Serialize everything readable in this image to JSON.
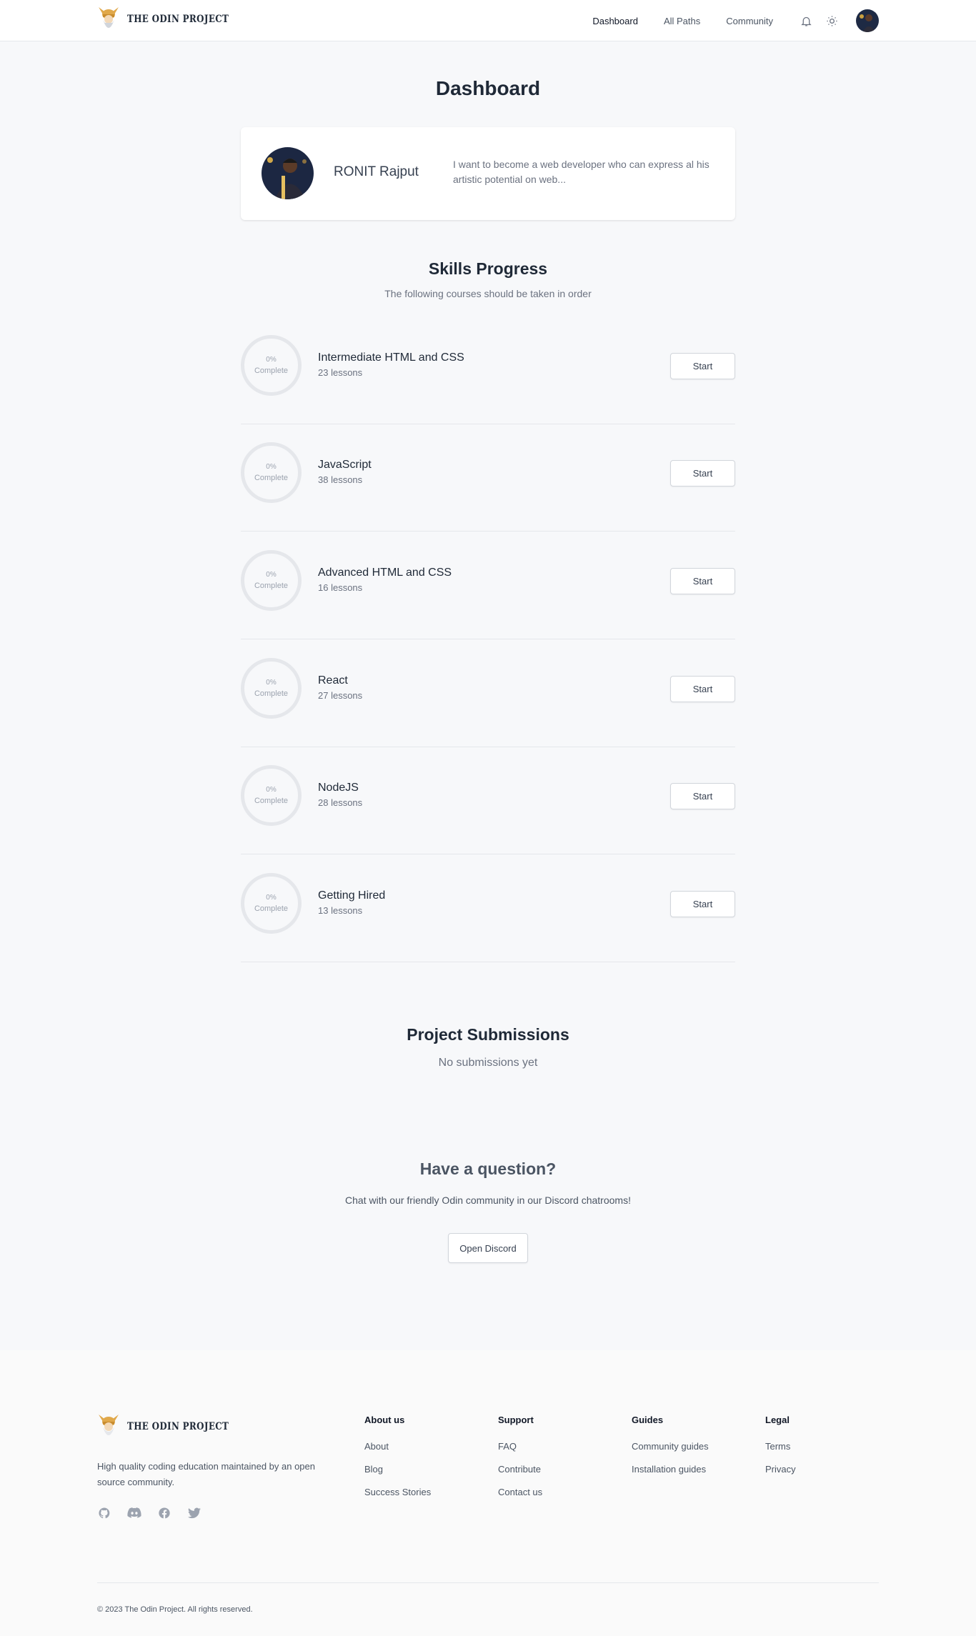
{
  "header": {
    "brand": "THE ODIN PROJECT",
    "nav": [
      "Dashboard",
      "All Paths",
      "Community"
    ],
    "icons": [
      "bell-icon",
      "sun-icon"
    ]
  },
  "main": {
    "title": "Dashboard",
    "profile": {
      "name": "RONIT Rajput",
      "bio": "I want to become a web developer who can express al his artistic potential on web..."
    },
    "skills": {
      "title": "Skills Progress",
      "subtitle": "The following courses should be taken in order",
      "courses": [
        {
          "name": "Intermediate HTML and CSS",
          "lessons": "23 lessons",
          "percent": "0%",
          "complete_label": "Complete",
          "button": "Start"
        },
        {
          "name": "JavaScript",
          "lessons": "38 lessons",
          "percent": "0%",
          "complete_label": "Complete",
          "button": "Start"
        },
        {
          "name": "Advanced HTML and CSS",
          "lessons": "16 lessons",
          "percent": "0%",
          "complete_label": "Complete",
          "button": "Start"
        },
        {
          "name": "React",
          "lessons": "27 lessons",
          "percent": "0%",
          "complete_label": "Complete",
          "button": "Start"
        },
        {
          "name": "NodeJS",
          "lessons": "28 lessons",
          "percent": "0%",
          "complete_label": "Complete",
          "button": "Start"
        },
        {
          "name": "Getting Hired",
          "lessons": "13 lessons",
          "percent": "0%",
          "complete_label": "Complete",
          "button": "Start"
        }
      ]
    },
    "submissions": {
      "title": "Project Submissions",
      "empty": "No submissions yet"
    },
    "question": {
      "title": "Have a question?",
      "text": "Chat with our friendly Odin community in our Discord chatrooms!",
      "button": "Open Discord"
    }
  },
  "footer": {
    "brand": "THE ODIN PROJECT",
    "tagline": "High quality coding education maintained by an open source community.",
    "socials": [
      "github-icon",
      "discord-icon",
      "facebook-icon",
      "twitter-icon"
    ],
    "columns": [
      {
        "heading": "About us",
        "links": [
          "About",
          "Blog",
          "Success Stories"
        ]
      },
      {
        "heading": "Support",
        "links": [
          "FAQ",
          "Contribute",
          "Contact us"
        ]
      },
      {
        "heading": "Guides",
        "links": [
          "Community guides",
          "Installation guides"
        ]
      },
      {
        "heading": "Legal",
        "links": [
          "Terms",
          "Privacy"
        ]
      }
    ],
    "copyright": "© 2023 The Odin Project. All rights reserved."
  },
  "colors": {
    "background": "#f7f8fa",
    "text": "#1f2937",
    "muted": "#6b7280",
    "border": "#e5e7eb",
    "logo_gold": "#e0a84a"
  }
}
